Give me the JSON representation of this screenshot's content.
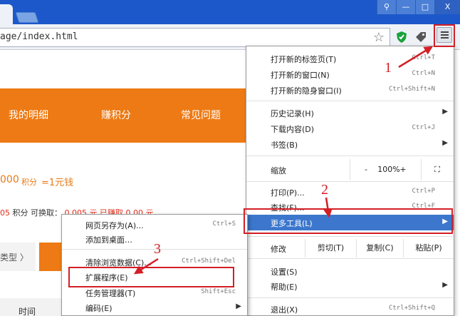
{
  "browser": {
    "url": "age/index.html",
    "window_buttons": [
      "⚲",
      "—",
      "□",
      "X"
    ]
  },
  "page": {
    "nav": [
      "我的明细",
      "赚积分",
      "常见问题"
    ],
    "rate": {
      "number": "000",
      "unit": "积分",
      "equals": "=1元钱"
    },
    "points_row": {
      "value": "05",
      "label1": "积分",
      "label2": "可换取：",
      "rest": "0.005 元 已赚取 0.00 元"
    },
    "type_tab": "类型 〉",
    "time_header": "时间"
  },
  "menu": {
    "items": [
      {
        "label": "打开新的标签页(T)",
        "shortcut": "Ctrl+T"
      },
      {
        "label": "打开新的窗口(N)",
        "shortcut": "Ctrl+N"
      },
      {
        "label": "打开新的隐身窗口(I)",
        "shortcut": "Ctrl+Shift+N"
      },
      {
        "label": "历史记录(H)",
        "arrow": "▶"
      },
      {
        "label": "下载内容(D)",
        "shortcut": "Ctrl+J"
      },
      {
        "label": "书签(B)",
        "arrow": "▶"
      },
      {
        "label": "打印(P)...",
        "shortcut": "Ctrl+P"
      },
      {
        "label": "查找(F)...",
        "shortcut": "Ctrl+F"
      },
      {
        "label": "更多工具(L)",
        "arrow": "▶"
      },
      {
        "label": "设置(S)"
      },
      {
        "label": "帮助(E)",
        "arrow": "▶"
      },
      {
        "label": "退出(X)",
        "shortcut": "Ctrl+Shift+Q"
      }
    ],
    "zoom": {
      "label": "缩放",
      "minus": "-",
      "value": "100%",
      "plus": "+",
      "fullscreen": "⛶"
    },
    "edit": {
      "label": "修改",
      "cut": "剪切(T)",
      "copy": "复制(C)",
      "paste": "粘贴(P)"
    }
  },
  "submenu": {
    "items": [
      {
        "label": "网页另存为(A)...",
        "shortcut": "Ctrl+S"
      },
      {
        "label": "添加到桌面…"
      },
      {
        "label": "清除浏览数据(C)...",
        "shortcut": "Ctrl+Shift+Del"
      },
      {
        "label": "扩展程序(E)"
      },
      {
        "label": "任务管理器(T)",
        "shortcut": "Shift+Esc"
      },
      {
        "label": "编码(E)",
        "arrow": "▶"
      }
    ]
  },
  "annotations": {
    "step1": "1",
    "step2": "2",
    "step3": "3",
    "color": "#d31f26"
  },
  "colors": {
    "accent_orange": "#ed7a14",
    "highlight_blue": "#3c77cd",
    "titlebar_blue": "#1c58c9"
  }
}
